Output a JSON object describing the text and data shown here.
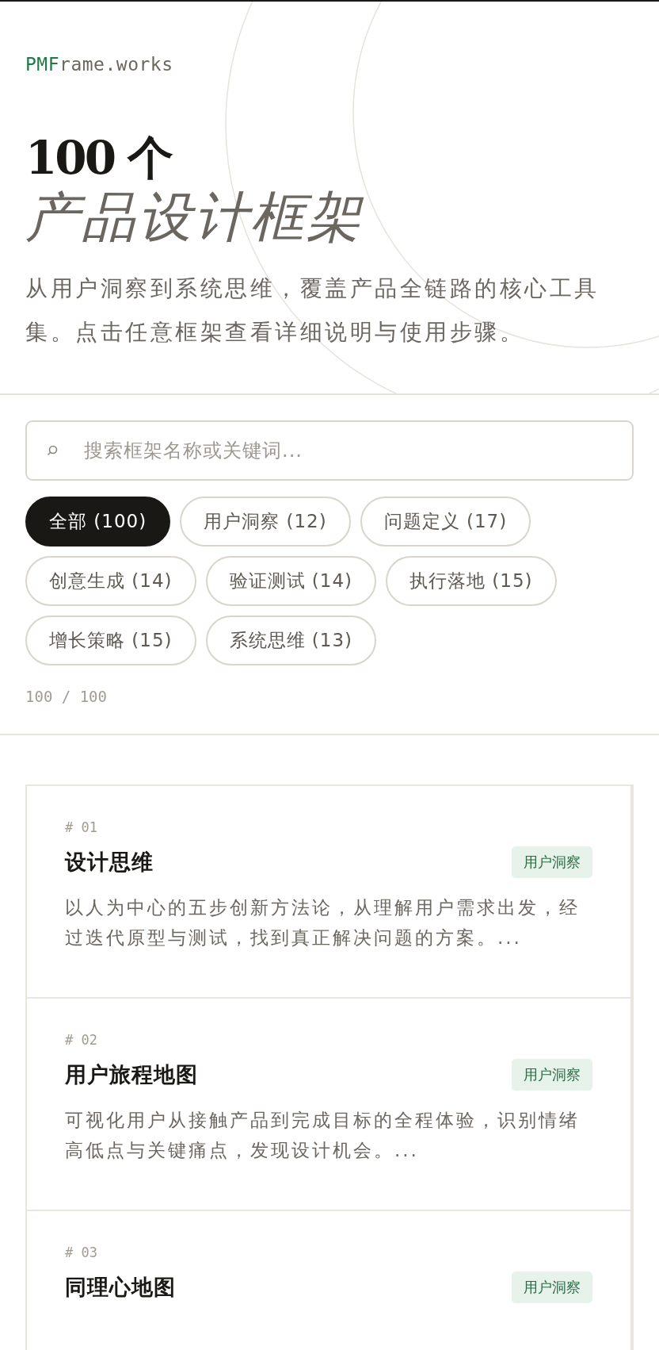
{
  "brand": {
    "accent": "PMF",
    "rest": "rame.works"
  },
  "hero": {
    "count": "100 个",
    "title": "产品设计框架",
    "description": "从用户洞察到系统思维，覆盖产品全链路的核心工具集。点击任意框架查看详细说明与使用步骤。"
  },
  "search": {
    "placeholder": "搜索框架名称或关键词..."
  },
  "filters": [
    {
      "label": "全部 (100)",
      "selected": true
    },
    {
      "label": "用户洞察 (12)",
      "selected": false
    },
    {
      "label": "问题定义 (17)",
      "selected": false
    },
    {
      "label": "创意生成 (14)",
      "selected": false
    },
    {
      "label": "验证测试 (14)",
      "selected": false
    },
    {
      "label": "执行落地 (15)",
      "selected": false
    },
    {
      "label": "增长策略 (15)",
      "selected": false
    },
    {
      "label": "系统思维 (13)",
      "selected": false
    }
  ],
  "result_count": "100 / 100",
  "cards": [
    {
      "number": "# 01",
      "title": "设计思维",
      "tag": "用户洞察",
      "description": "以人为中心的五步创新方法论，从理解用户需求出发，经过迭代原型与测试，找到真正解决问题的方案。..."
    },
    {
      "number": "# 02",
      "title": "用户旅程地图",
      "tag": "用户洞察",
      "description": "可视化用户从接触产品到完成目标的全程体验，识别情绪高低点与关键痛点，发现设计机会。..."
    },
    {
      "number": "# 03",
      "title": "同理心地图",
      "tag": "用户洞察"
    }
  ]
}
